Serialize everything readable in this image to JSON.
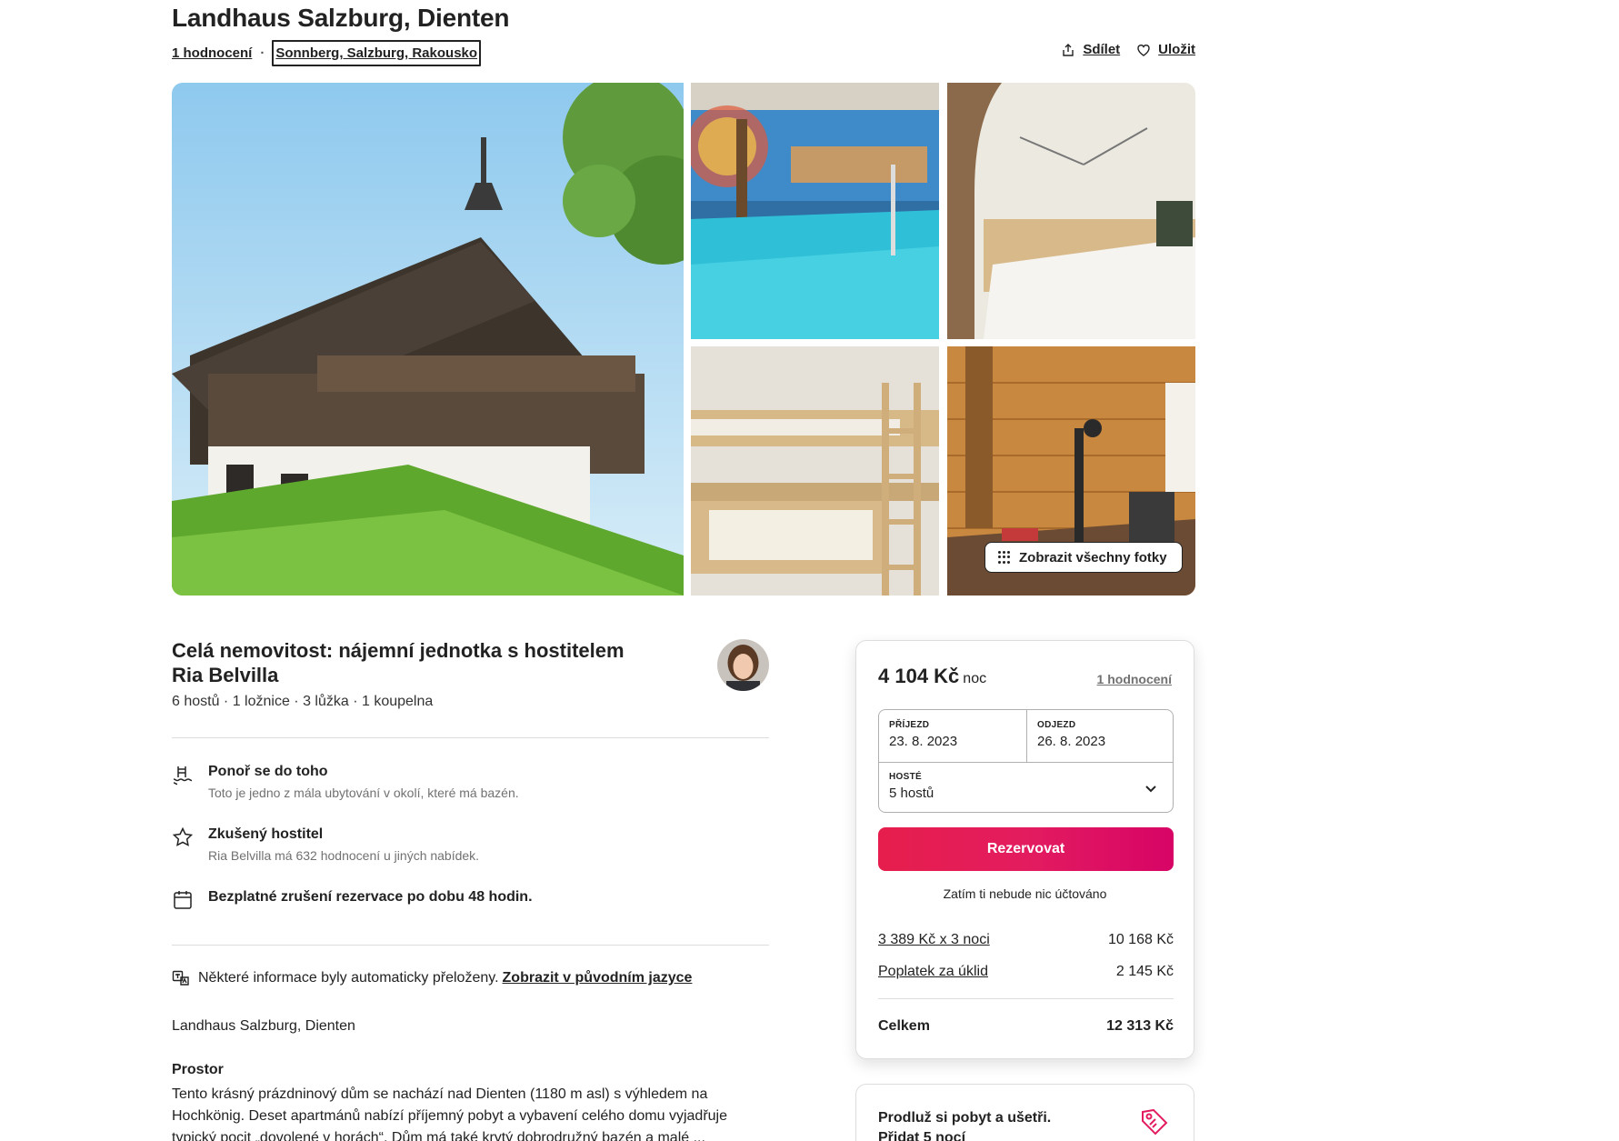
{
  "header": {
    "title": "Landhaus Salzburg, Dienten",
    "reviews_link": "1 hodnocení",
    "location": "Sonnberg, Salzburg, Rakousko",
    "share_label": "Sdílet",
    "save_label": "Uložit"
  },
  "gallery": {
    "show_all_label": "Zobrazit všechny fotky",
    "photos": [
      "house-exterior",
      "indoor-pool",
      "bedroom",
      "bunk-bed-room",
      "fitness-room"
    ]
  },
  "host": {
    "heading_line1": "Celá nemovitost: nájemní jednotka s hostitelem",
    "heading_line2": "Ria Belvilla",
    "specs": "6 hostů · 1 ložnice · 3 lůžka · 1 koupelna"
  },
  "features": [
    {
      "icon": "pool-icon",
      "title": "Ponoř se do toho",
      "subtitle": "Toto je jedno z mála ubytování v okolí, které má bazén."
    },
    {
      "icon": "star-icon",
      "title": "Zkušený hostitel",
      "subtitle": "Ria Belvilla má 632 hodnocení u jiných nabídek."
    },
    {
      "icon": "calendar-icon",
      "title": "Bezplatné zrušení rezervace po dobu 48 hodin.",
      "subtitle": ""
    }
  ],
  "translation": {
    "note": "Některé informace byly automaticky přeloženy.",
    "link": "Zobrazit v původním jazyce"
  },
  "description": {
    "name": "Landhaus Salzburg, Dienten",
    "section_title": "Prostor",
    "text": "Tento krásný prázdninový dům se nachází nad Dienten (1180 m asl) s výhledem na Hochkönig. Deset apartmánů nabízí příjemný pobyt a vybavení celého domu vyjadřuje typický pocit „dovolené v horách“. Dům má také krytý dobrodružný bazén a malé ..."
  },
  "booking": {
    "price": "4 104 Kč",
    "price_unit": "noc",
    "reviews_link": "1 hodnocení",
    "checkin_label": "PŘÍJEZD",
    "checkin_value": "23. 8. 2023",
    "checkout_label": "ODJEZD",
    "checkout_value": "26. 8. 2023",
    "guests_label": "HOSTÉ",
    "guests_value": "5 hostů",
    "reserve_label": "Rezervovat",
    "no_charge": "Zatím ti nebude nic účtováno",
    "lines": [
      {
        "label": "3 389 Kč x 3 noci",
        "amount": "10 168 Kč"
      },
      {
        "label": "Poplatek za úklid",
        "amount": "2 145 Kč"
      }
    ],
    "total_label": "Celkem",
    "total_amount": "12 313 Kč",
    "accent_color": "#e31c5f"
  },
  "promo": {
    "title": "Prodluž si pobyt a ušetři.",
    "link": "Přidat 5 nocí"
  }
}
